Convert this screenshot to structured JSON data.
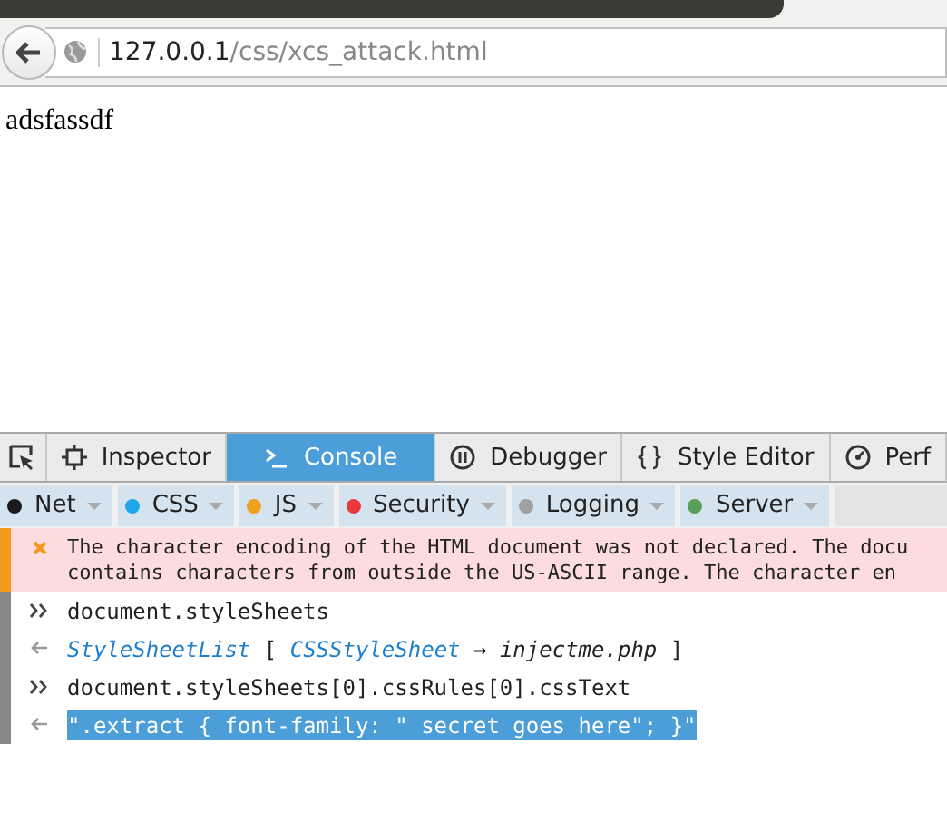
{
  "address_bar": {
    "host": "127.0.0.1",
    "path": "/css/xcs_attack.html"
  },
  "page": {
    "text": "adsfassdf"
  },
  "devtools": {
    "tabs": [
      {
        "label": "Inspector",
        "selected": false
      },
      {
        "label": "Console",
        "selected": true
      },
      {
        "label": "Debugger",
        "selected": false
      },
      {
        "label": "Style Editor",
        "selected": false
      },
      {
        "label": "Perf",
        "selected": false
      }
    ],
    "filters": [
      {
        "label": "Net",
        "color": "#1a1a1a"
      },
      {
        "label": "CSS",
        "color": "#1ea7e8"
      },
      {
        "label": "JS",
        "color": "#f0a020"
      },
      {
        "label": "Security",
        "color": "#e8383d"
      },
      {
        "label": "Logging",
        "color": "#a0a0a0"
      },
      {
        "label": "Server",
        "color": "#5a9e5a"
      }
    ],
    "console": [
      {
        "kind": "error",
        "highlighted": false,
        "lines": [
          "The character encoding of the HTML document was not declared. The docu",
          "contains characters from outside the US-ASCII range. The character en"
        ]
      },
      {
        "kind": "input",
        "highlighted": false,
        "parts": [
          {
            "kind": "plain",
            "text": "document.styleSheets"
          }
        ]
      },
      {
        "kind": "output",
        "highlighted": false,
        "parts": [
          {
            "kind": "object",
            "text": "StyleSheetList"
          },
          {
            "kind": "plain",
            "text": " [ "
          },
          {
            "kind": "object",
            "text": "CSSStyleSheet"
          },
          {
            "kind": "plain",
            "text": " → "
          },
          {
            "kind": "source",
            "text": "injectme.php"
          },
          {
            "kind": "plain",
            "text": " ]"
          }
        ]
      },
      {
        "kind": "input",
        "highlighted": false,
        "parts": [
          {
            "kind": "plain",
            "text": "document.styleSheets[0].cssRules[0].cssText"
          }
        ]
      },
      {
        "kind": "output",
        "highlighted": true,
        "parts": [
          {
            "kind": "plain",
            "text": "\".extract { font-family: \" secret goes here\"; }\""
          }
        ]
      }
    ]
  }
}
